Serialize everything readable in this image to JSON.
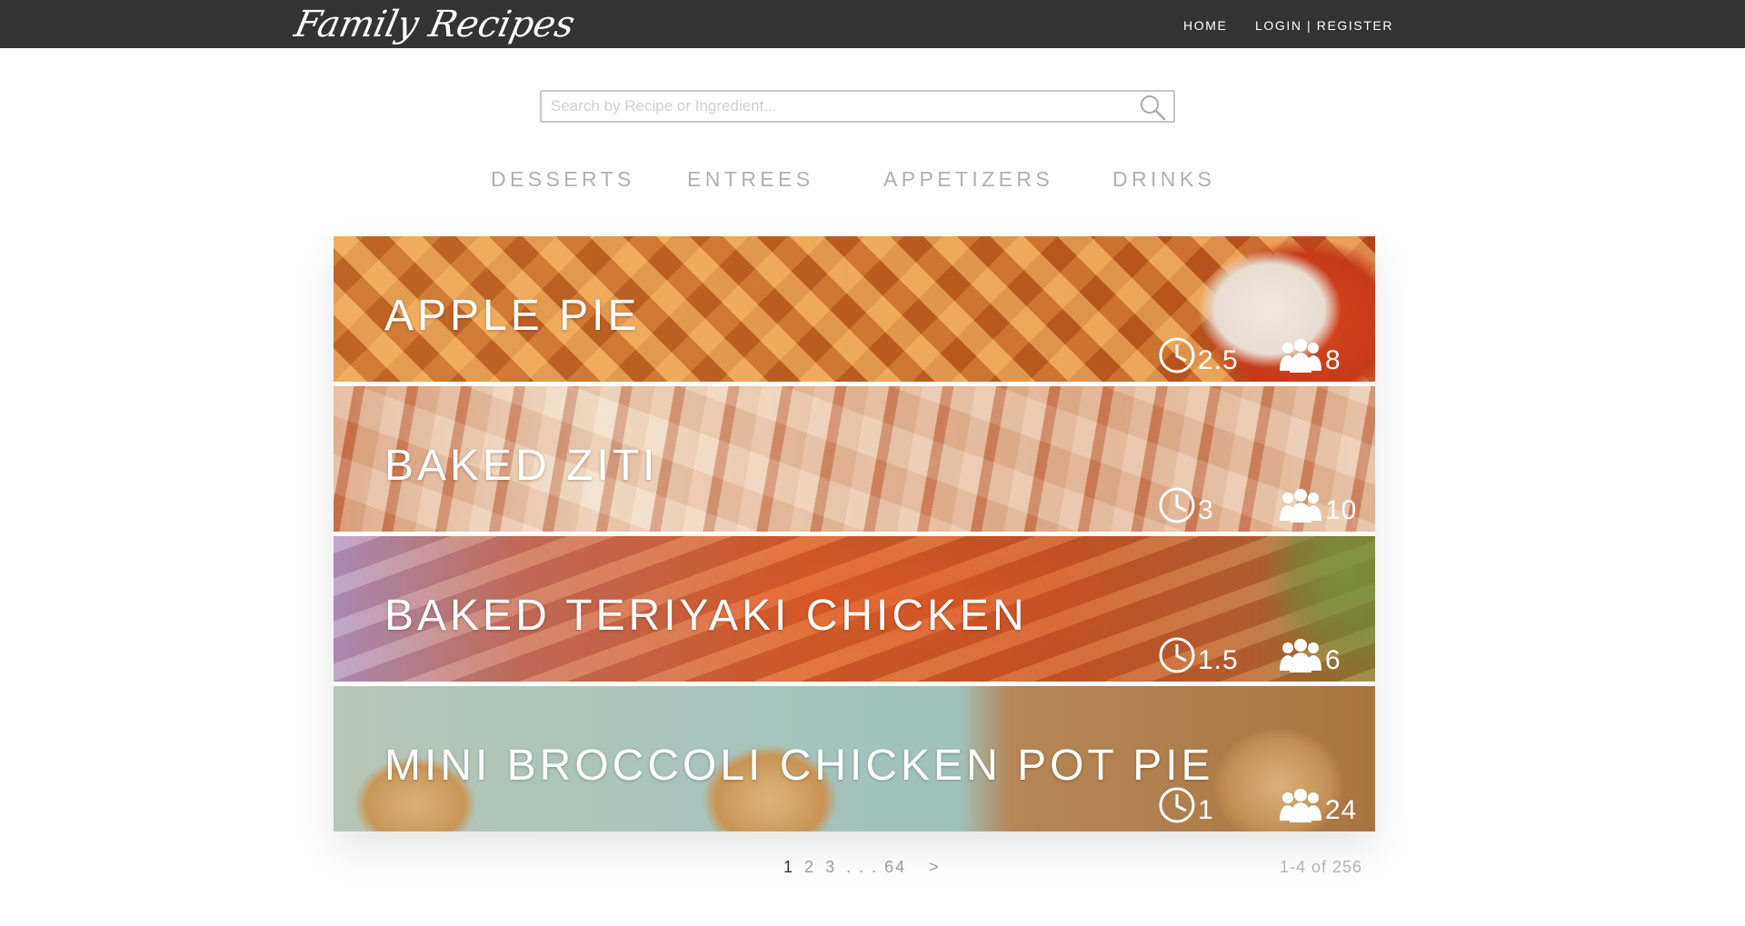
{
  "header": {
    "logo": "Family Recipes",
    "nav": {
      "home": "HOME",
      "login": "LOGIN | REGISTER"
    }
  },
  "search": {
    "placeholder": "Search by Recipe or Ingredient...",
    "value": ""
  },
  "categories": [
    "DESSERTS",
    "ENTREES",
    "APPETIZERS",
    "DRINKS"
  ],
  "recipes": [
    {
      "title": "APPLE PIE",
      "time": "2.5",
      "servings": "8"
    },
    {
      "title": "BAKED ZITI",
      "time": "3",
      "servings": "10"
    },
    {
      "title": "BAKED TERIYAKI CHICKEN",
      "time": "1.5",
      "servings": "6"
    },
    {
      "title": "MINI BROCCOLI CHICKEN POT PIE",
      "time": "1",
      "servings": "24"
    }
  ],
  "pagination": {
    "pages": [
      "1",
      "2",
      "3",
      ". . . 64",
      ">"
    ],
    "current": "1",
    "count_text": "1-4  of 256"
  },
  "icons": {
    "time": "clock-icon",
    "servings": "people-icon",
    "search": "search-icon"
  },
  "colors": {
    "topbar": "#333333",
    "category": "#b0b0b0",
    "text_light": "#ffffff"
  }
}
